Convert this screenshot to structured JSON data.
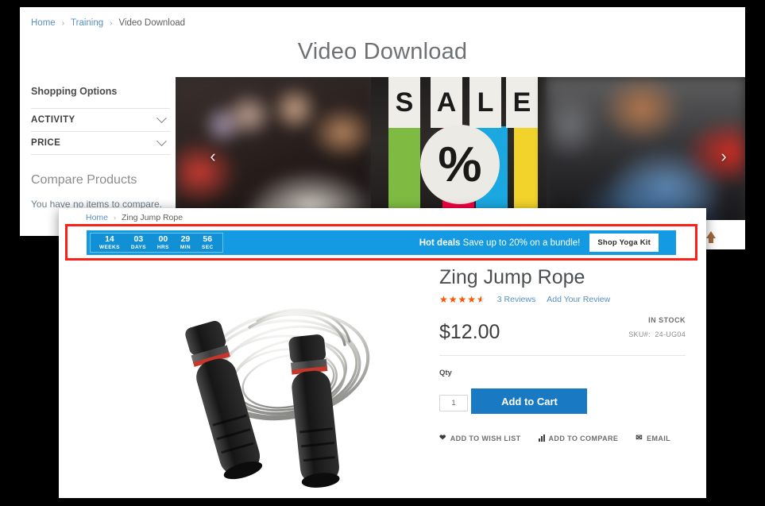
{
  "back_page": {
    "breadcrumb": [
      {
        "label": "Home",
        "link": true
      },
      {
        "label": "Training",
        "link": true
      },
      {
        "label": "Video Download",
        "link": false
      }
    ],
    "title": "Video Download",
    "sidebar": {
      "heading": "Shopping Options",
      "filters": [
        {
          "label": "ACTIVITY",
          "icon": "chevron-down-icon"
        },
        {
          "label": "PRICE",
          "icon": "chevron-down-icon"
        }
      ],
      "compare_title": "Compare Products",
      "compare_note": "You have no items to compare."
    },
    "carousel": {
      "prev_icon": "chevron-left-icon",
      "next_icon": "chevron-right-icon",
      "banner_letters": [
        "S",
        "A",
        "L",
        "E"
      ],
      "banner_percent": "%",
      "stripe_colors": [
        "#7fbb43",
        "#f3003f",
        "#1ba7e0",
        "#f2d32b"
      ]
    },
    "behind_widget": {
      "chevron_icon": "chevron-down-icon",
      "scroll_top_icon": "arrow-up-icon"
    }
  },
  "modal": {
    "breadcrumb": [
      {
        "label": "Home",
        "link": true
      },
      {
        "label": "Zing Jump Rope",
        "link": false
      }
    ],
    "highlight_color": "#fb2116",
    "banner": {
      "background": "#149ae2",
      "countdown": [
        {
          "value": "14",
          "label": "WEEKS"
        },
        {
          "value": "03",
          "label": "DAYS"
        },
        {
          "value": "00",
          "label": "HRS"
        },
        {
          "value": "29",
          "label": "MIN"
        },
        {
          "value": "56",
          "label": "SEC"
        }
      ],
      "message_bold": "Hot deals",
      "message_rest": " Save up to 20% on a bundle!",
      "cta_label": "Shop Yoga Kit"
    },
    "product": {
      "image_alt": "zing-jump-rope-photo",
      "name": "Zing Jump Rope",
      "rating_percent": 90,
      "stars_glyphs": "★★★★★",
      "reviews_label": "3 Reviews",
      "add_review_label": "Add Your Review",
      "price": "$12.00",
      "stock_status": "IN STOCK",
      "sku_label": "SKU#:",
      "sku_value": "24-UG04",
      "qty_label": "Qty",
      "qty_value": "1",
      "add_to_cart_label": "Add to Cart",
      "add_to_cart_color": "#1979c3",
      "actions": [
        {
          "label": "ADD TO WISH LIST",
          "icon": "heart-icon"
        },
        {
          "label": "ADD TO COMPARE",
          "icon": "bar-chart-icon"
        },
        {
          "label": "EMAIL",
          "icon": "mail-icon"
        }
      ]
    }
  }
}
